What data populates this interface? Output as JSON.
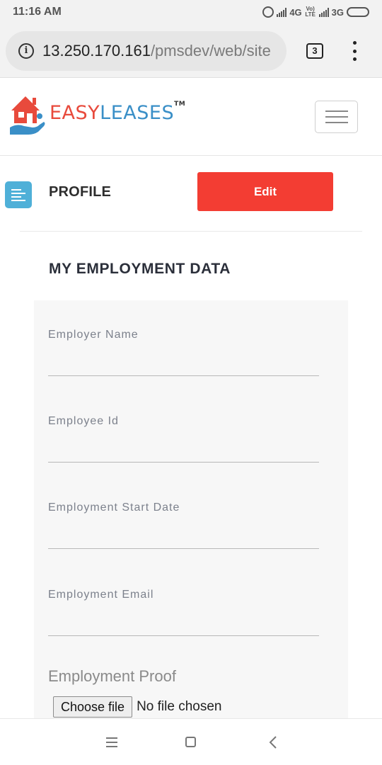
{
  "status_bar": {
    "time": "11:16 AM",
    "network_1": "4G",
    "volte": "Vo) LTE",
    "network_2": "3G"
  },
  "browser": {
    "url_host": "13.250.170.161",
    "url_path": "/pmsdev/web/site",
    "tab_count": "3"
  },
  "header": {
    "logo_easy": "EASY",
    "logo_leases": "LEASES",
    "logo_tm": "TM"
  },
  "profile": {
    "title": "PROFILE",
    "edit_label": "Edit"
  },
  "section": {
    "title": "MY EMPLOYMENT DATA"
  },
  "fields": [
    {
      "label": "Employer Name",
      "value": ""
    },
    {
      "label": "Employee Id",
      "value": ""
    },
    {
      "label": "Employment Start Date",
      "value": ""
    },
    {
      "label": "Employment Email",
      "value": ""
    }
  ],
  "proof": {
    "label": "Employment Proof",
    "button_label": "Choose file",
    "status": "No file chosen"
  },
  "colors": {
    "accent_red": "#f33d33",
    "logo_blue": "#3a8fc7",
    "icon_blue": "#4fb0d8"
  }
}
